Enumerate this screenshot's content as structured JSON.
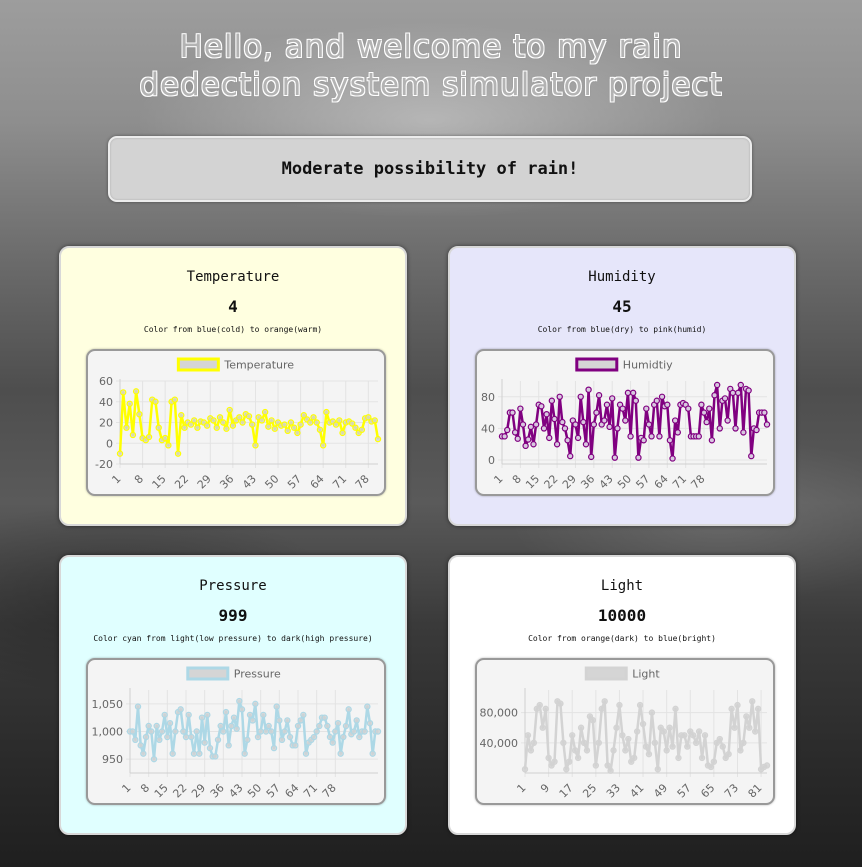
{
  "header": {
    "title_line1": "Hello, and welcome to my rain",
    "title_line2": "dedection system simulator project"
  },
  "status": {
    "message": "Moderate possibility of rain!"
  },
  "cards": [
    {
      "name": "Temperature",
      "value": "4",
      "description": "Color from blue(cold) to orange(warm)",
      "background": "#ffffe0",
      "color": "#ffff00",
      "chart_data": {
        "type": "line",
        "series": [
          {
            "name": "Temperature",
            "values": [
              -10,
              49,
              15,
              38,
              8,
              50,
              28,
              5,
              3,
              6,
              42,
              40,
              15,
              3,
              5,
              -2,
              40,
              42,
              -10,
              27,
              15,
              20,
              18,
              22,
              15,
              21,
              20,
              17,
              24,
              22,
              15,
              25,
              20,
              14,
              32,
              17,
              22,
              25,
              20,
              28,
              26,
              18,
              -2,
              25,
              22,
              30,
              16,
              22,
              14,
              20,
              17,
              18,
              12,
              20,
              15,
              10,
              18,
              27,
              23,
              20,
              25,
              20,
              13,
              -2,
              30,
              20,
              21,
              18,
              22,
              10,
              20,
              21,
              19,
              15,
              10,
              13,
              24,
              25,
              21,
              22,
              4
            ]
          }
        ],
        "ylim": [
          -20,
          60
        ],
        "yticks": [
          -20,
          0,
          20,
          40,
          60
        ],
        "xticks": [
          "1",
          "8",
          "15",
          "22",
          "29",
          "36",
          "43",
          "50",
          "57",
          "64",
          "71",
          "78"
        ]
      }
    },
    {
      "name": "Humidity",
      "value": "45",
      "description": "Color from blue(dry) to pink(humid)",
      "background": "#e6e6fa",
      "color": "#800080",
      "chart_data": {
        "type": "line",
        "series": [
          {
            "name": "Humidtiy",
            "values": [
              30,
              30,
              38,
              60,
              60,
              35,
              27,
              65,
              45,
              18,
              26,
              42,
              20,
              45,
              70,
              68,
              40,
              58,
              28,
              75,
              52,
              20,
              80,
              48,
              40,
              25,
              5,
              50,
              45,
              28,
              80,
              48,
              20,
              89,
              4,
              45,
              60,
              82,
              45,
              50,
              70,
              42,
              78,
              3,
              40,
              70,
              65,
              50,
              85,
              30,
              85,
              75,
              3,
              28,
              25,
              65,
              45,
              30,
              70,
              75,
              30,
              80,
              68,
              70,
              25,
              2,
              50,
              35,
              70,
              72,
              70,
              65,
              30,
              30,
              30,
              30,
              70,
              60,
              48,
              65,
              25,
              82,
              95,
              40,
              75,
              78,
              50,
              90,
              85,
              40,
              85,
              95,
              35,
              90,
              88,
              5,
              40,
              38,
              60,
              60,
              60,
              45
            ]
          }
        ],
        "ylim": [
          -5,
          100
        ],
        "yticks": [
          0,
          40,
          80
        ],
        "xticks": [
          "1",
          "8",
          "15",
          "22",
          "29",
          "36",
          "43",
          "50",
          "57",
          "64",
          "71",
          "78"
        ]
      }
    },
    {
      "name": "Pressure",
      "value": "999",
      "description": "Color cyan from light(low pressure) to dark(high pressure)",
      "background": "#e0ffff",
      "color": "#add8e6",
      "chart_data": {
        "type": "line",
        "series": [
          {
            "name": "Pressure",
            "values": [
              1000,
              1000,
              985,
              1045,
              975,
              960,
              990,
              1010,
              1000,
              950,
              1010,
              985,
              1000,
              1030,
              990,
              1015,
              960,
              1000,
              1035,
              1040,
              1000,
              990,
              1030,
              990,
              960,
              1000,
              960,
              1025,
              980,
              1030,
              970,
              955,
              955,
              985,
              1010,
              1000,
              1035,
              975,
              1010,
              1025,
              1005,
              1055,
              1040,
              960,
              985,
              1030,
              1020,
              1050,
              990,
              1000,
              1030,
              1000,
              1010,
              1000,
              970,
              1045,
              1020,
              985,
              1000,
              1020,
              990,
              975,
              975,
              1010,
              1020,
              1030,
              960,
              980,
              985,
              990,
              1000,
              1010,
              1025,
              1025,
              1010,
              990,
              980,
              1000,
              1015,
              960,
              990,
              1010,
              1040,
              995,
              1000,
              1020,
              990,
              1000,
              1000,
              1045,
              1015,
              960,
              1000,
              1000
            ]
          }
        ],
        "ylim": [
          925,
          1075
        ],
        "yticks": [
          950,
          1000,
          1050
        ],
        "yticklabels": [
          "950",
          "1,000",
          "1,050"
        ],
        "xticks": [
          "1",
          "8",
          "15",
          "22",
          "29",
          "36",
          "43",
          "50",
          "57",
          "64",
          "71",
          "78"
        ]
      }
    },
    {
      "name": "Light",
      "value": "10000",
      "description": "Color from orange(dark) to blue(bright)",
      "background": "#ffffff",
      "color": "#d3d3d3",
      "chart_data": {
        "type": "line",
        "series": [
          {
            "name": "Light",
            "values": [
              5000,
              50000,
              30000,
              40000,
              85000,
              90000,
              60000,
              85000,
              20000,
              10000,
              15000,
              95000,
              92000,
              40000,
              5000,
              15000,
              50000,
              30000,
              20000,
              60000,
              40000,
              30000,
              75000,
              70000,
              10000,
              40000,
              85000,
              95000,
              10000,
              3000,
              30000,
              60000,
              90000,
              50000,
              30000,
              45000,
              15000,
              20000,
              55000,
              90000,
              65000,
              35000,
              25000,
              80000,
              40000,
              5000,
              60000,
              55000,
              30000,
              60000,
              35000,
              85000,
              20000,
              50000,
              50000,
              35000,
              55000,
              50000,
              40000,
              55000,
              20000,
              50000,
              10000,
              8000,
              15000,
              40000,
              45000,
              35000,
              20000,
              25000,
              85000,
              60000,
              90000,
              30000,
              40000,
              75000,
              60000,
              95000,
              55000,
              85000,
              5000,
              8000,
              10000
            ]
          }
        ],
        "ylim": [
          0,
          110000
        ],
        "yticks": [
          40000,
          80000
        ],
        "yticklabels": [
          "40,000",
          "80,000"
        ],
        "xticks": [
          "1",
          "9",
          "17",
          "25",
          "33",
          "41",
          "49",
          "57",
          "65",
          "73",
          "81"
        ]
      }
    }
  ]
}
